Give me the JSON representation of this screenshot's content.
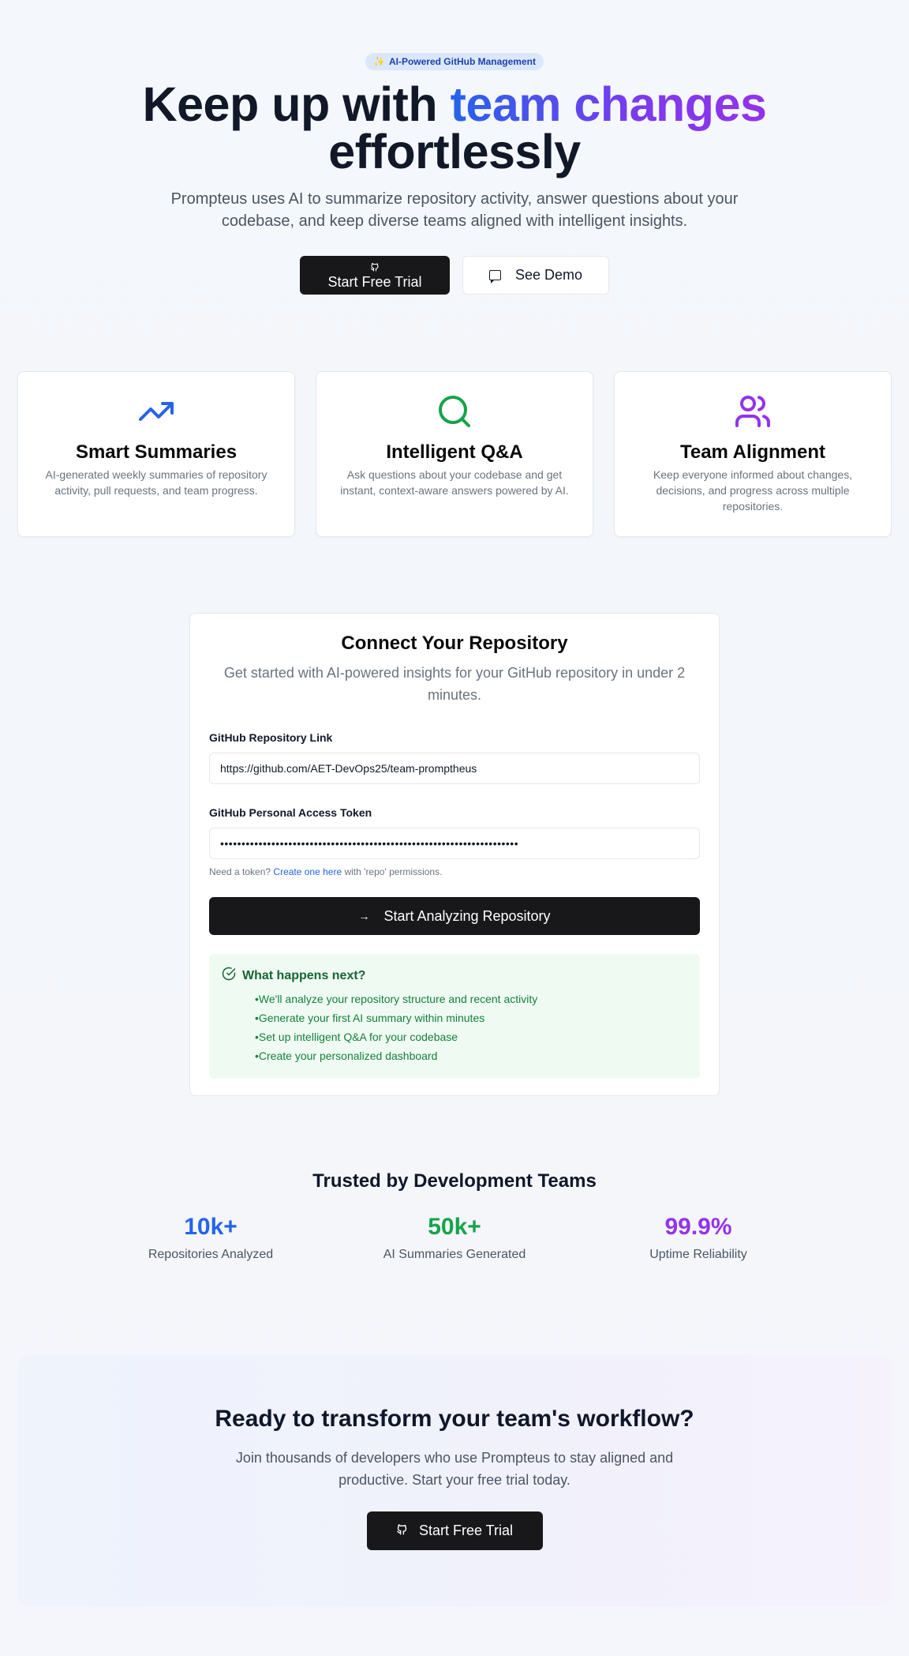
{
  "hero": {
    "badge_icon": "sparkles-icon",
    "badge": "AI-Powered GitHub Management",
    "title_part1": "Keep up with ",
    "title_highlight": "team changes",
    "title_part2": "effortlessly",
    "subtitle": "Prompteus uses AI to summarize repository activity, answer questions about your codebase, and keep diverse teams aligned with intelligent insights.",
    "primary_button": "Start Free Trial",
    "secondary_button": "See Demo"
  },
  "features": [
    {
      "icon": "trending-up-icon",
      "title": "Smart Summaries",
      "description": "AI-generated weekly summaries of repository activity, pull requests, and team progress.",
      "color": "#2563eb"
    },
    {
      "icon": "search-icon",
      "title": "Intelligent Q&A",
      "description": "Ask questions about your codebase and get instant, context-aware answers powered by AI.",
      "color": "#16a34a"
    },
    {
      "icon": "users-icon",
      "title": "Team Alignment",
      "description": "Keep everyone informed about changes, decisions, and progress across multiple repositories.",
      "color": "#9333ea"
    }
  ],
  "connect": {
    "title": "Connect Your Repository",
    "subtitle": "Get started with AI-powered insights for your GitHub repository in under 2 minutes.",
    "repo_label": "GitHub Repository Link",
    "repo_value": "https://github.com/AET-DevOps25/team-promptheus",
    "token_label": "GitHub Personal Access Token",
    "token_value": "••••••••••••••••••••••••••••••••••••••••••••••••••••••••••••••••••••••",
    "hint_prefix": "Need a token? ",
    "hint_link": "Create one here",
    "hint_suffix": " with 'repo' permissions.",
    "submit_button": "Start Analyzing Repository",
    "next_title": "What happens next?",
    "next_items": [
      "We'll analyze your repository structure and recent activity",
      "Generate your first AI summary within minutes",
      "Set up intelligent Q&A for your codebase",
      "Create your personalized dashboard"
    ]
  },
  "trust": {
    "title": "Trusted by Development Teams",
    "stats": [
      {
        "value": "10k+",
        "label": "Repositories Analyzed",
        "color": "#2563eb"
      },
      {
        "value": "50k+",
        "label": "AI Summaries Generated",
        "color": "#16a34a"
      },
      {
        "value": "99.9%",
        "label": "Uptime Reliability",
        "color": "#9333ea"
      }
    ]
  },
  "cta": {
    "title": "Ready to transform your team's workflow?",
    "subtitle": "Join thousands of developers who use Prompteus to stay aligned and productive. Start your free trial today.",
    "button": "Start Free Trial"
  }
}
